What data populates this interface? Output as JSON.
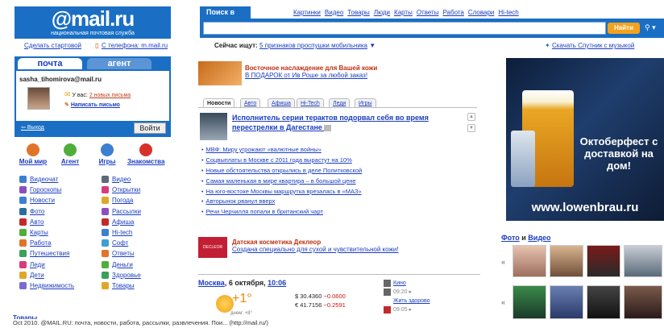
{
  "logo": {
    "text": "@mail.ru",
    "sub": "национальная почтовая служба"
  },
  "top_links": {
    "make_start": "Сделать стартовой",
    "phone": "С телефона: m.mail.ru"
  },
  "mail_tabs": {
    "mail": "почта",
    "agent": "агент"
  },
  "mailbox": {
    "user": "sasha_tihomirova@mail.ru",
    "uvas_prefix": "У вас:",
    "new_letters": "2 новых письма",
    "write": "Написать письмо",
    "logout": "Выход",
    "enter": "Войти"
  },
  "big_icons": [
    {
      "label": "Мой мир",
      "color": "#e0742a"
    },
    {
      "label": "Агент",
      "color": "#4fae3a"
    },
    {
      "label": "Игры",
      "color": "#3d7fd1"
    },
    {
      "label": "Знакомства",
      "color": "#d8312a"
    }
  ],
  "services_left": [
    {
      "label": "Видеочат",
      "color": "#3d7fd1"
    },
    {
      "label": "Гороскопы",
      "color": "#8a4fc1"
    },
    {
      "label": "Новости",
      "color": "#3d7fd1"
    },
    {
      "label": "Фото",
      "color": "#2a6ea0"
    },
    {
      "label": "Авто",
      "color": "#c22a2a"
    },
    {
      "label": "Карты",
      "color": "#4fae3a"
    },
    {
      "label": "Работа",
      "color": "#e0742a"
    },
    {
      "label": "Путешествия",
      "color": "#3aa05a"
    },
    {
      "label": "Леди",
      "color": "#d83a7a"
    },
    {
      "label": "Дети",
      "color": "#e0a82a"
    },
    {
      "label": "Недвижимость",
      "color": "#7a6ad1"
    }
  ],
  "services_right": [
    {
      "label": "Видео",
      "color": "#5a6a7a"
    },
    {
      "label": "Открытки",
      "color": "#d83a7a"
    },
    {
      "label": "Погода",
      "color": "#e0a82a"
    },
    {
      "label": "Рассылки",
      "color": "#8a4fc1"
    },
    {
      "label": "Афиша",
      "color": "#c22a2a"
    },
    {
      "label": "Hi-tech",
      "color": "#3d7fd1"
    },
    {
      "label": "Софт",
      "color": "#3da0d1"
    },
    {
      "label": "Ответы",
      "color": "#e0742a"
    },
    {
      "label": "Деньги",
      "color": "#4fae3a"
    },
    {
      "label": "Здоровье",
      "color": "#3aa05a"
    },
    {
      "label": "Товары",
      "color": "#e0a82a"
    }
  ],
  "search": {
    "tab": "Поиск в Интернете",
    "links": [
      "Картинки",
      "Видео",
      "Товары",
      "Люди",
      "Карты",
      "Ответы",
      "Работа",
      "Словари",
      "Hi-tech"
    ],
    "button": "Найти",
    "now_prefix": "Сейчас ищут:",
    "now_link": "5 признаков проспушки мобильника",
    "sputnik": "Скачать Спутник с музыкой"
  },
  "promo1": {
    "title": "Восточное наслаждение для Вашей кожи",
    "link": "В ПОДАРОК от Ив Роше за любой заказ!"
  },
  "news_tabs": [
    "Новости",
    "Авто",
    "Афиша",
    "Hi-Tech",
    "Леди",
    "Игры"
  ],
  "top_news": "Исполнитель серии терактов подорвал себя во время перестрелки в Дагестане",
  "news": [
    "МВФ: Миру угрожают «валютные войны»",
    "Соцвыплаты в Москве с 2011 года вырастут на 10%",
    "Новые обстоятельства открылись в деле Политковской",
    "Самая маленькая в мире квартира – в большой цене",
    "На юго-востоке Москвы маршрутка врезалась в «МАЗ»",
    "Авторынок рванул вверх",
    "Речи Черчилля попали в британский чарт"
  ],
  "promo2": {
    "brand": "DECLEOR",
    "title": "Датская косметика Деклеор",
    "link": "Создана специально для сухой и чувствительной кожи!"
  },
  "weather": {
    "city": "Москва",
    "date": ", 6 октября, ",
    "time": "10:06",
    "temp": "+1°",
    "day": "днем: +8°"
  },
  "fx": {
    "usd": "30.4360",
    "usd_d": "−0.0600",
    "eur": "41.7156",
    "eur_d": "−0.2591"
  },
  "tv": {
    "kino": "Кино",
    "t1": "09:20 ▸",
    "show": "Жить здорово",
    "t2": "09:05 ▸"
  },
  "ad": {
    "slogan": "Октоберфест с доставкой на дом!",
    "url": "www.lowenbrau.ru"
  },
  "foto": {
    "a": "Фото",
    "and": " и ",
    "b": "Видео"
  },
  "bottom": {
    "tovary": "Товары",
    "status": "Oct 2010. @MAIL.RU: почта, новости, работа, рассылки, развлечения. Пои... (http://mail.ru/)"
  }
}
